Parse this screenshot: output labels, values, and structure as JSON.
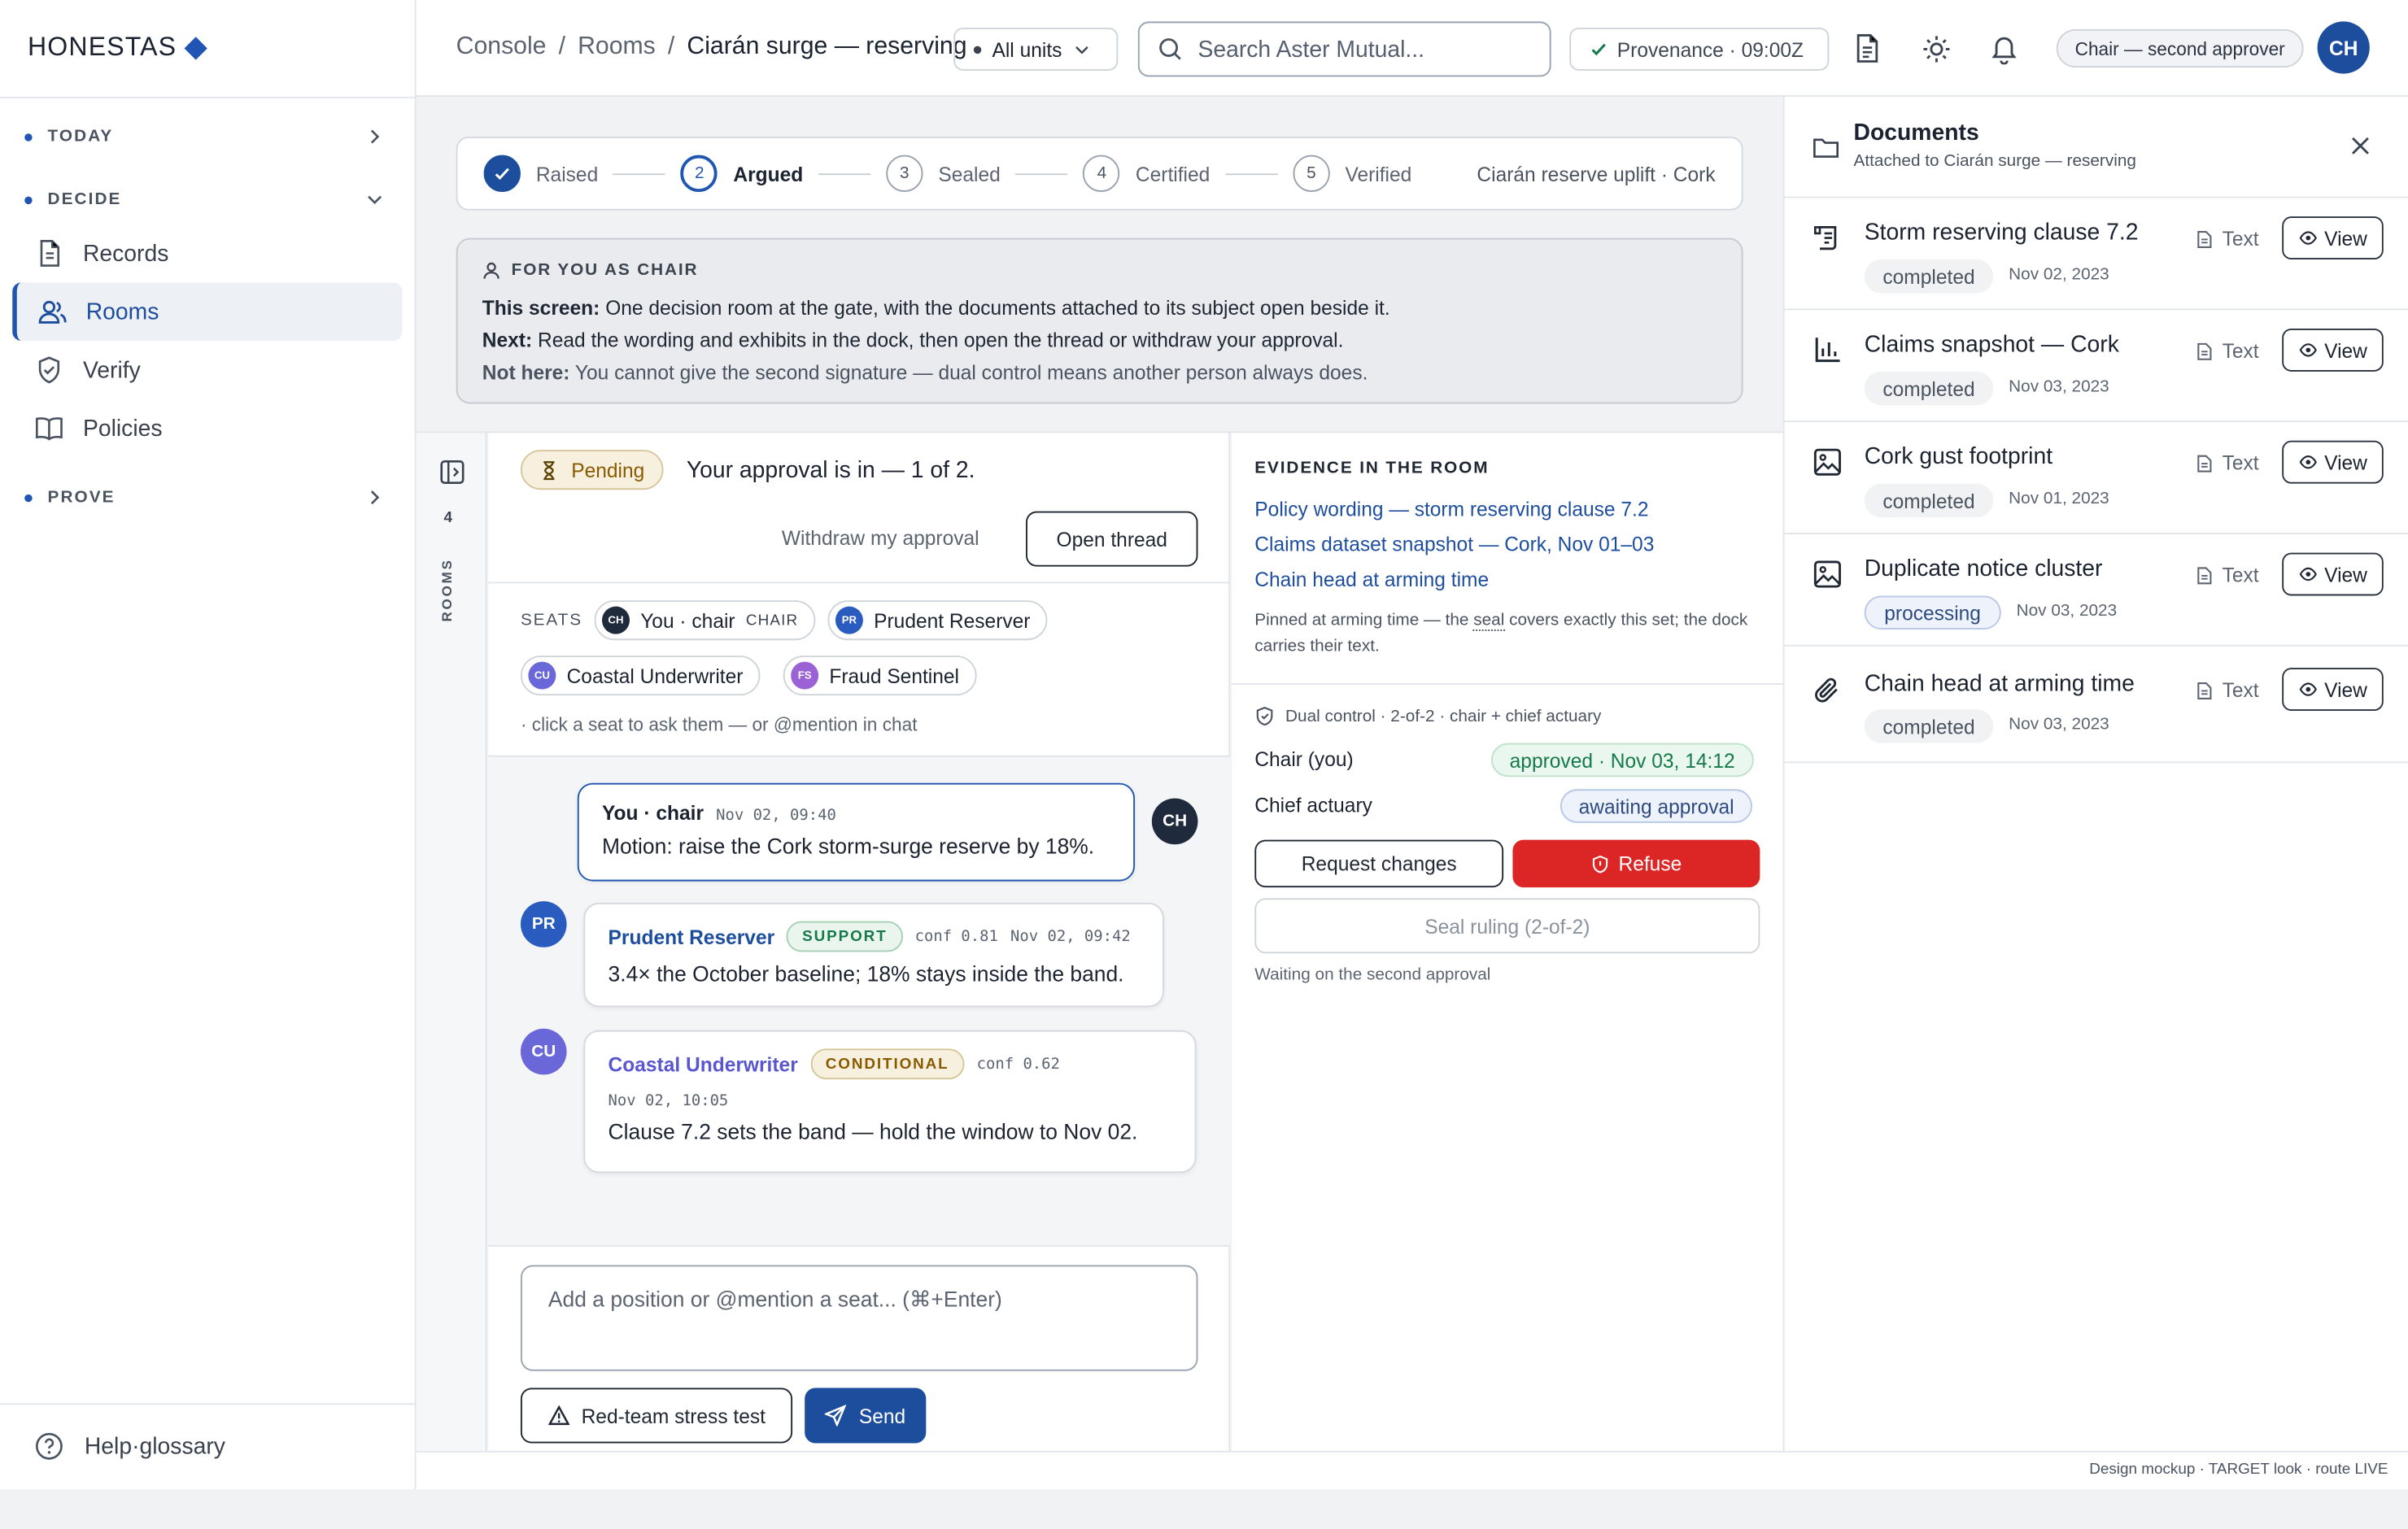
{
  "brand": {
    "name": "HONESTAS"
  },
  "sidebar": {
    "sections": [
      {
        "label": "TODAY"
      },
      {
        "label": "DECIDE"
      },
      {
        "label": "PROVE"
      }
    ],
    "items": [
      {
        "label": "Records",
        "icon": "file-icon"
      },
      {
        "label": "Rooms",
        "icon": "people-icon",
        "active": true
      },
      {
        "label": "Verify",
        "icon": "shield-check-icon"
      },
      {
        "label": "Policies",
        "icon": "book-icon"
      }
    ],
    "help_label": "Help·glossary"
  },
  "topbar": {
    "breadcrumb": [
      "Console",
      "Rooms",
      "Ciarán surge — reserving"
    ],
    "units_label": "All units",
    "search_placeholder": "Search Aster Mutual...",
    "provenance": "Provenance · 09:00Z",
    "role_badge": "Chair — second approver",
    "avatar": "CH"
  },
  "stepper": {
    "steps": [
      {
        "num": "1",
        "label": "Raised",
        "state": "done"
      },
      {
        "num": "2",
        "label": "Argued",
        "state": "current"
      },
      {
        "num": "3",
        "label": "Sealed",
        "state": "todo"
      },
      {
        "num": "4",
        "label": "Certified",
        "state": "todo"
      },
      {
        "num": "5",
        "label": "Verified",
        "state": "todo"
      }
    ],
    "context": "Ciarán reserve uplift · Cork"
  },
  "chair_info": {
    "heading": "FOR YOU AS CHAIR",
    "lines": [
      {
        "label": "This screen:",
        "text": "One decision room at the gate, with the documents attached to its subject open beside it."
      },
      {
        "label": "Next:",
        "text": "Read the wording and exhibits in the dock, then open the thread or withdraw your approval."
      },
      {
        "label": "Not here:",
        "text": "You cannot give the second signature — dual control means another person always does."
      }
    ]
  },
  "rail": {
    "count": "4",
    "label": "ROOMS"
  },
  "room": {
    "status": "Pending",
    "approval_text": "Your approval is in — 1 of 2.",
    "withdraw_label": "Withdraw my approval",
    "open_thread_label": "Open thread",
    "seats_label": "SEATS",
    "seats": [
      {
        "initials": "CH",
        "name": "You · chair",
        "tag": "CHAIR",
        "color": "#1f2a3c"
      },
      {
        "initials": "PR",
        "name": "Prudent Reserver",
        "color": "#2a5bbf"
      },
      {
        "initials": "CU",
        "name": "Coastal Underwriter",
        "color": "#6a67d8"
      },
      {
        "initials": "FS",
        "name": "Fraud Sentinel",
        "color": "#9b62d6"
      }
    ],
    "seats_hint": "· click a seat to ask them — or @mention in chat",
    "messages": [
      {
        "initials": "CH",
        "author": "You · chair",
        "meta": "Nov 02, 09:40",
        "text": "Motion: raise the Cork storm-surge reserve by 18%."
      },
      {
        "initials": "PR",
        "author": "Prudent Reserver",
        "stance": "SUPPORT",
        "conf": "conf 0.81",
        "meta": "Nov 02, 09:42",
        "text": "3.4× the October baseline; 18% stays inside the band."
      },
      {
        "initials": "CU",
        "author": "Coastal Underwriter",
        "stance": "CONDITIONAL",
        "conf": "conf 0.62",
        "meta": "Nov 02, 10:05",
        "text": "Clause 7.2 sets the band — hold the window to Nov 02."
      }
    ],
    "composer_placeholder": "Add a position or @mention a seat... (⌘+Enter)",
    "redteam_label": "Red-team stress test",
    "send_label": "Send"
  },
  "evidence": {
    "heading": "EVIDENCE IN THE ROOM",
    "links": [
      "Policy wording — storm reserving clause 7.2",
      "Claims dataset snapshot — Cork, Nov 01–03",
      "Chain head at arming time"
    ],
    "note_pre": "Pinned at arming time — the ",
    "note_seal": "seal",
    "note_post": " covers exactly this set; the dock carries their text.",
    "dual_control": "Dual control · 2-of-2 · chair + chief actuary",
    "approvers": [
      {
        "role": "Chair (you)",
        "status": "approved · Nov 03, 14:12"
      },
      {
        "role": "Chief actuary",
        "status": "awaiting approval"
      }
    ],
    "request_changes_label": "Request changes",
    "refuse_label": "Refuse",
    "seal_label": "Seal ruling (2-of-2)",
    "waiting_text": "Waiting on the second approval"
  },
  "documents": {
    "title": "Documents",
    "subtitle": "Attached to Ciarán surge — reserving",
    "items": [
      {
        "title": "Storm reserving clause 7.2",
        "status": "completed",
        "date": "Nov 02, 2023",
        "type": "Text",
        "action": "View",
        "icon": "scroll-icon"
      },
      {
        "title": "Claims snapshot — Cork",
        "status": "completed",
        "date": "Nov 03, 2023",
        "type": "Text",
        "action": "View",
        "icon": "bar-chart-icon"
      },
      {
        "title": "Cork gust footprint",
        "status": "completed",
        "date": "Nov 01, 2023",
        "type": "Text",
        "action": "View",
        "icon": "image-icon"
      },
      {
        "title": "Duplicate notice cluster",
        "status": "processing",
        "date": "Nov 03, 2023",
        "type": "Text",
        "action": "View",
        "icon": "image-icon"
      },
      {
        "title": "Chain head at arming time",
        "status": "completed",
        "date": "Nov 03, 2023",
        "type": "Text",
        "action": "View",
        "icon": "paperclip-icon"
      }
    ]
  },
  "footer": {
    "text": "Design mockup · TARGET look · route LIVE"
  },
  "colors": {
    "accent": "#1d4e9e",
    "danger": "#dc2626",
    "success": "#16794a",
    "warning": "#8a5a00"
  }
}
